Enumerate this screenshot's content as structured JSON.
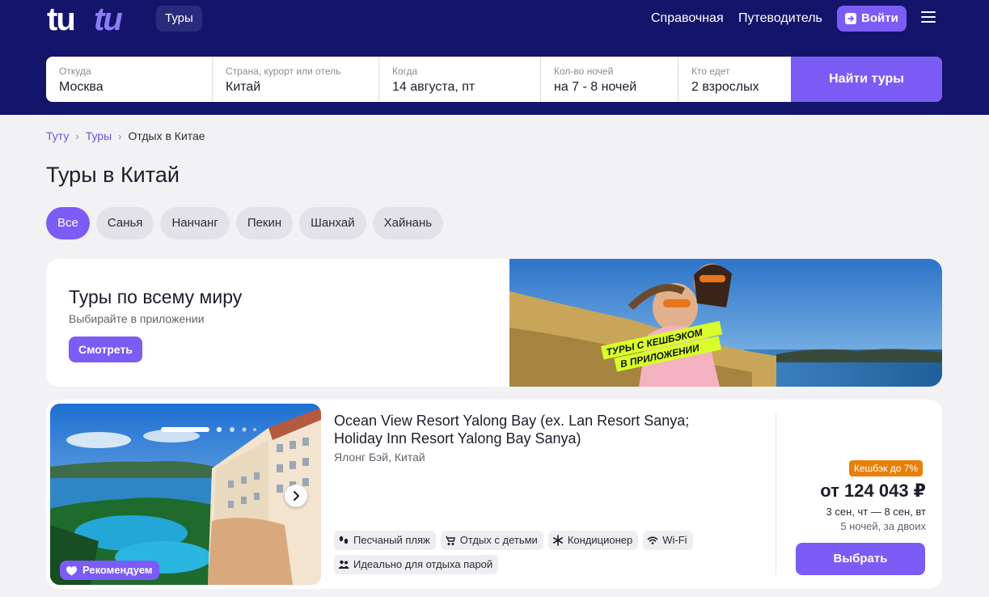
{
  "colors": {
    "header_bg": "#14146b",
    "accent": "#7b5cf5",
    "page_bg": "#f2f2f5",
    "cashback": "#e8800a"
  },
  "header": {
    "logo_text": "tutu",
    "section_tag": "Туры",
    "nav": [
      "Справочная",
      "Путеводитель"
    ],
    "login_label": "Войти",
    "menu_icon": "burger-icon"
  },
  "search": {
    "fields": [
      {
        "label": "Откуда",
        "value": "Москва"
      },
      {
        "label": "Страна, курорт или отель",
        "value": "Китай"
      },
      {
        "label": "Когда",
        "value": "14 августа, пт"
      },
      {
        "label": "Кол-во ночей",
        "value": "на 7 - 8 ночей"
      },
      {
        "label": "Кто едет",
        "value": "2 взрослых"
      }
    ],
    "submit_label": "Найти туры"
  },
  "breadcrumbs": [
    "Туту",
    "Туры",
    "Отдых в Китае"
  ],
  "page_title": "Туры в Китай",
  "filters": [
    "Все",
    "Санья",
    "Нанчанг",
    "Пекин",
    "Шанхай",
    "Хайнань"
  ],
  "active_filter": "Все",
  "promo": {
    "title": "Туры по всему миру",
    "subtitle": "Выбирайте в приложении",
    "button_label": "Смотреть",
    "image_caption_line1": "ТУРЫ С КЕШБЭКОМ",
    "image_caption_line2": "В ПРИЛОЖЕНИИ"
  },
  "hotel": {
    "badge": "Рекомендуем",
    "name": "Ocean View Resort Yalong Bay (ex. Lan Resort Sanya; Holiday Inn Resort Yalong Bay Sanya)",
    "location": "Ялонг Бэй, Китай",
    "amenities": [
      {
        "label": "Песчаный пляж",
        "icon": "footprints-icon"
      },
      {
        "label": "Отдых с детьми",
        "icon": "stroller-icon"
      },
      {
        "label": "Кондиционер",
        "icon": "snowflake-icon"
      },
      {
        "label": "Wi-Fi",
        "icon": "wifi-icon"
      },
      {
        "label": "Идеально для отдыха парой",
        "icon": "couple-icon"
      }
    ],
    "cashback": "Кешбэк до 7%",
    "price": "от 124 043 ₽",
    "dates": "3 сен, чт — 8 сен, вт",
    "nights": "5 ночей, за двоих",
    "choose_label": "Выбрать"
  }
}
